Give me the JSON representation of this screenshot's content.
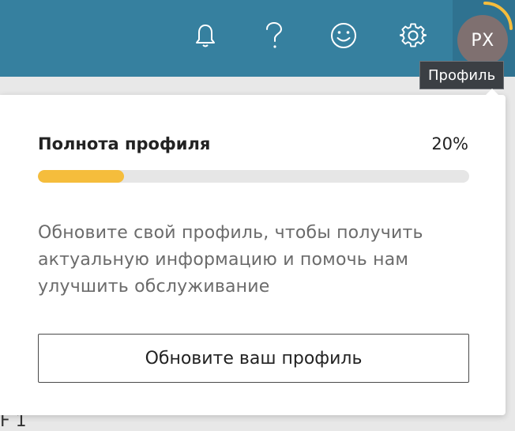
{
  "header": {
    "icons": [
      "bell-icon",
      "help-icon",
      "feedback-smiley-icon",
      "settings-gear-icon"
    ],
    "avatar_initials": "PX",
    "tooltip": "Профиль"
  },
  "page": {
    "stub_text": "F 1"
  },
  "profile_card": {
    "title": "Полнота профиля",
    "percent_label": "20%",
    "progress_fraction": 0.2,
    "description": "Обновите свой профиль, чтобы получить актуальную информацию и помочь нам улучшить обслуживание",
    "button_label": "Обновите ваш профиль"
  },
  "colors": {
    "header_bg": "#36809f",
    "progress_fill": "#f5bd3c",
    "avatar_bg": "#7f7070"
  }
}
